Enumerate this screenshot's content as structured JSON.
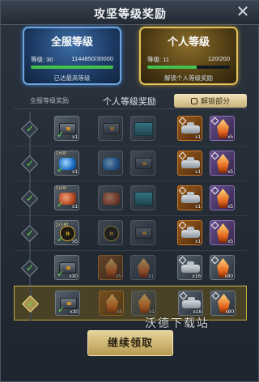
{
  "title": "攻坚等级奖励",
  "server_card": {
    "title": "全服等级",
    "level_label": "等级: 30",
    "progress_text": "1144850/30000",
    "progress_fraction": 1.0,
    "note": "已达最高等级"
  },
  "personal_card": {
    "title": "个人等级",
    "level_label": "等级: 11",
    "progress_text": "120/200",
    "progress_fraction": 0.6,
    "note": "解锁个人等级奖励"
  },
  "tabs": {
    "server": "全服等级奖励",
    "personal": "个人等级奖励",
    "locked": "解锁部分"
  },
  "rows": [
    {
      "server": {
        "qty": "x1",
        "tag": ""
      },
      "p1": {
        "qty": ""
      },
      "p2": {
        "qty": ""
      },
      "l1": {
        "qty": "x1"
      },
      "l2": {
        "qty": "x5"
      }
    },
    {
      "server": {
        "qty": "x1",
        "tag": "1500"
      },
      "p1": {
        "qty": ""
      },
      "p2": {
        "qty": ""
      },
      "l1": {
        "qty": "x1"
      },
      "l2": {
        "qty": "x5"
      }
    },
    {
      "server": {
        "qty": "x1",
        "tag": "1500"
      },
      "p1": {
        "qty": ""
      },
      "p2": {
        "qty": ""
      },
      "l1": {
        "qty": "x1"
      },
      "l2": {
        "qty": "x5"
      }
    },
    {
      "server": {
        "qty": "x5",
        "tag": "2小时"
      },
      "p1": {
        "qty": ""
      },
      "p2": {
        "qty": ""
      },
      "l1": {
        "qty": "x1"
      },
      "l2": {
        "qty": "x5"
      }
    },
    {
      "server": {
        "qty": "x30",
        "tag": ""
      },
      "p1": {
        "qty": "x5"
      },
      "p2": {
        "qty": "x1"
      },
      "l1": {
        "qty": "x16"
      },
      "l2": {
        "qty": "x80"
      }
    },
    {
      "server": {
        "qty": "x30",
        "tag": ""
      },
      "p1": {
        "qty": "x5"
      },
      "p2": {
        "qty": "x1"
      },
      "l1": {
        "qty": "x16"
      },
      "l2": {
        "qty": "x80"
      }
    }
  ],
  "continue_button": "继续领取",
  "watermark": "沃德下载站",
  "colors": {
    "check": "#5fe246",
    "gold": "#e6d49b",
    "blue_border": "#6ea5e2"
  }
}
